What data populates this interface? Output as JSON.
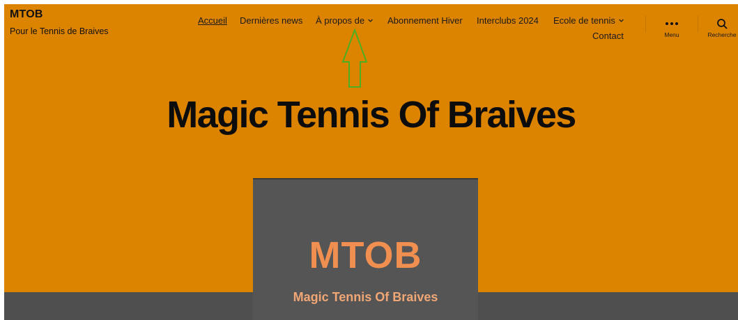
{
  "site": {
    "title": "MTOB",
    "tagline": "Pour le Tennis de Braives"
  },
  "nav": {
    "items": [
      {
        "label": "Accueil",
        "current": true
      },
      {
        "label": "Dernières news"
      },
      {
        "label": "À propos de",
        "has_submenu": true
      },
      {
        "label": "Abonnement Hiver"
      },
      {
        "label": "Interclubs 2024"
      },
      {
        "label": "Ecole de tennis",
        "has_submenu": true
      },
      {
        "label": "Contact"
      }
    ]
  },
  "toggles": {
    "menu_label": "Menu",
    "search_label": "Recherche",
    "menu_icon": "ellipsis-icon",
    "search_icon": "search-icon"
  },
  "hero": {
    "title": "Magic Tennis Of Braives"
  },
  "logo": {
    "text": "MTOB",
    "subtitle": "Magic Tennis Of Braives"
  },
  "colors": {
    "background": "#dc8300",
    "logo_card": "#555555",
    "logo_accent": "#f08f50",
    "annotation_arrow": "#4caf22"
  }
}
